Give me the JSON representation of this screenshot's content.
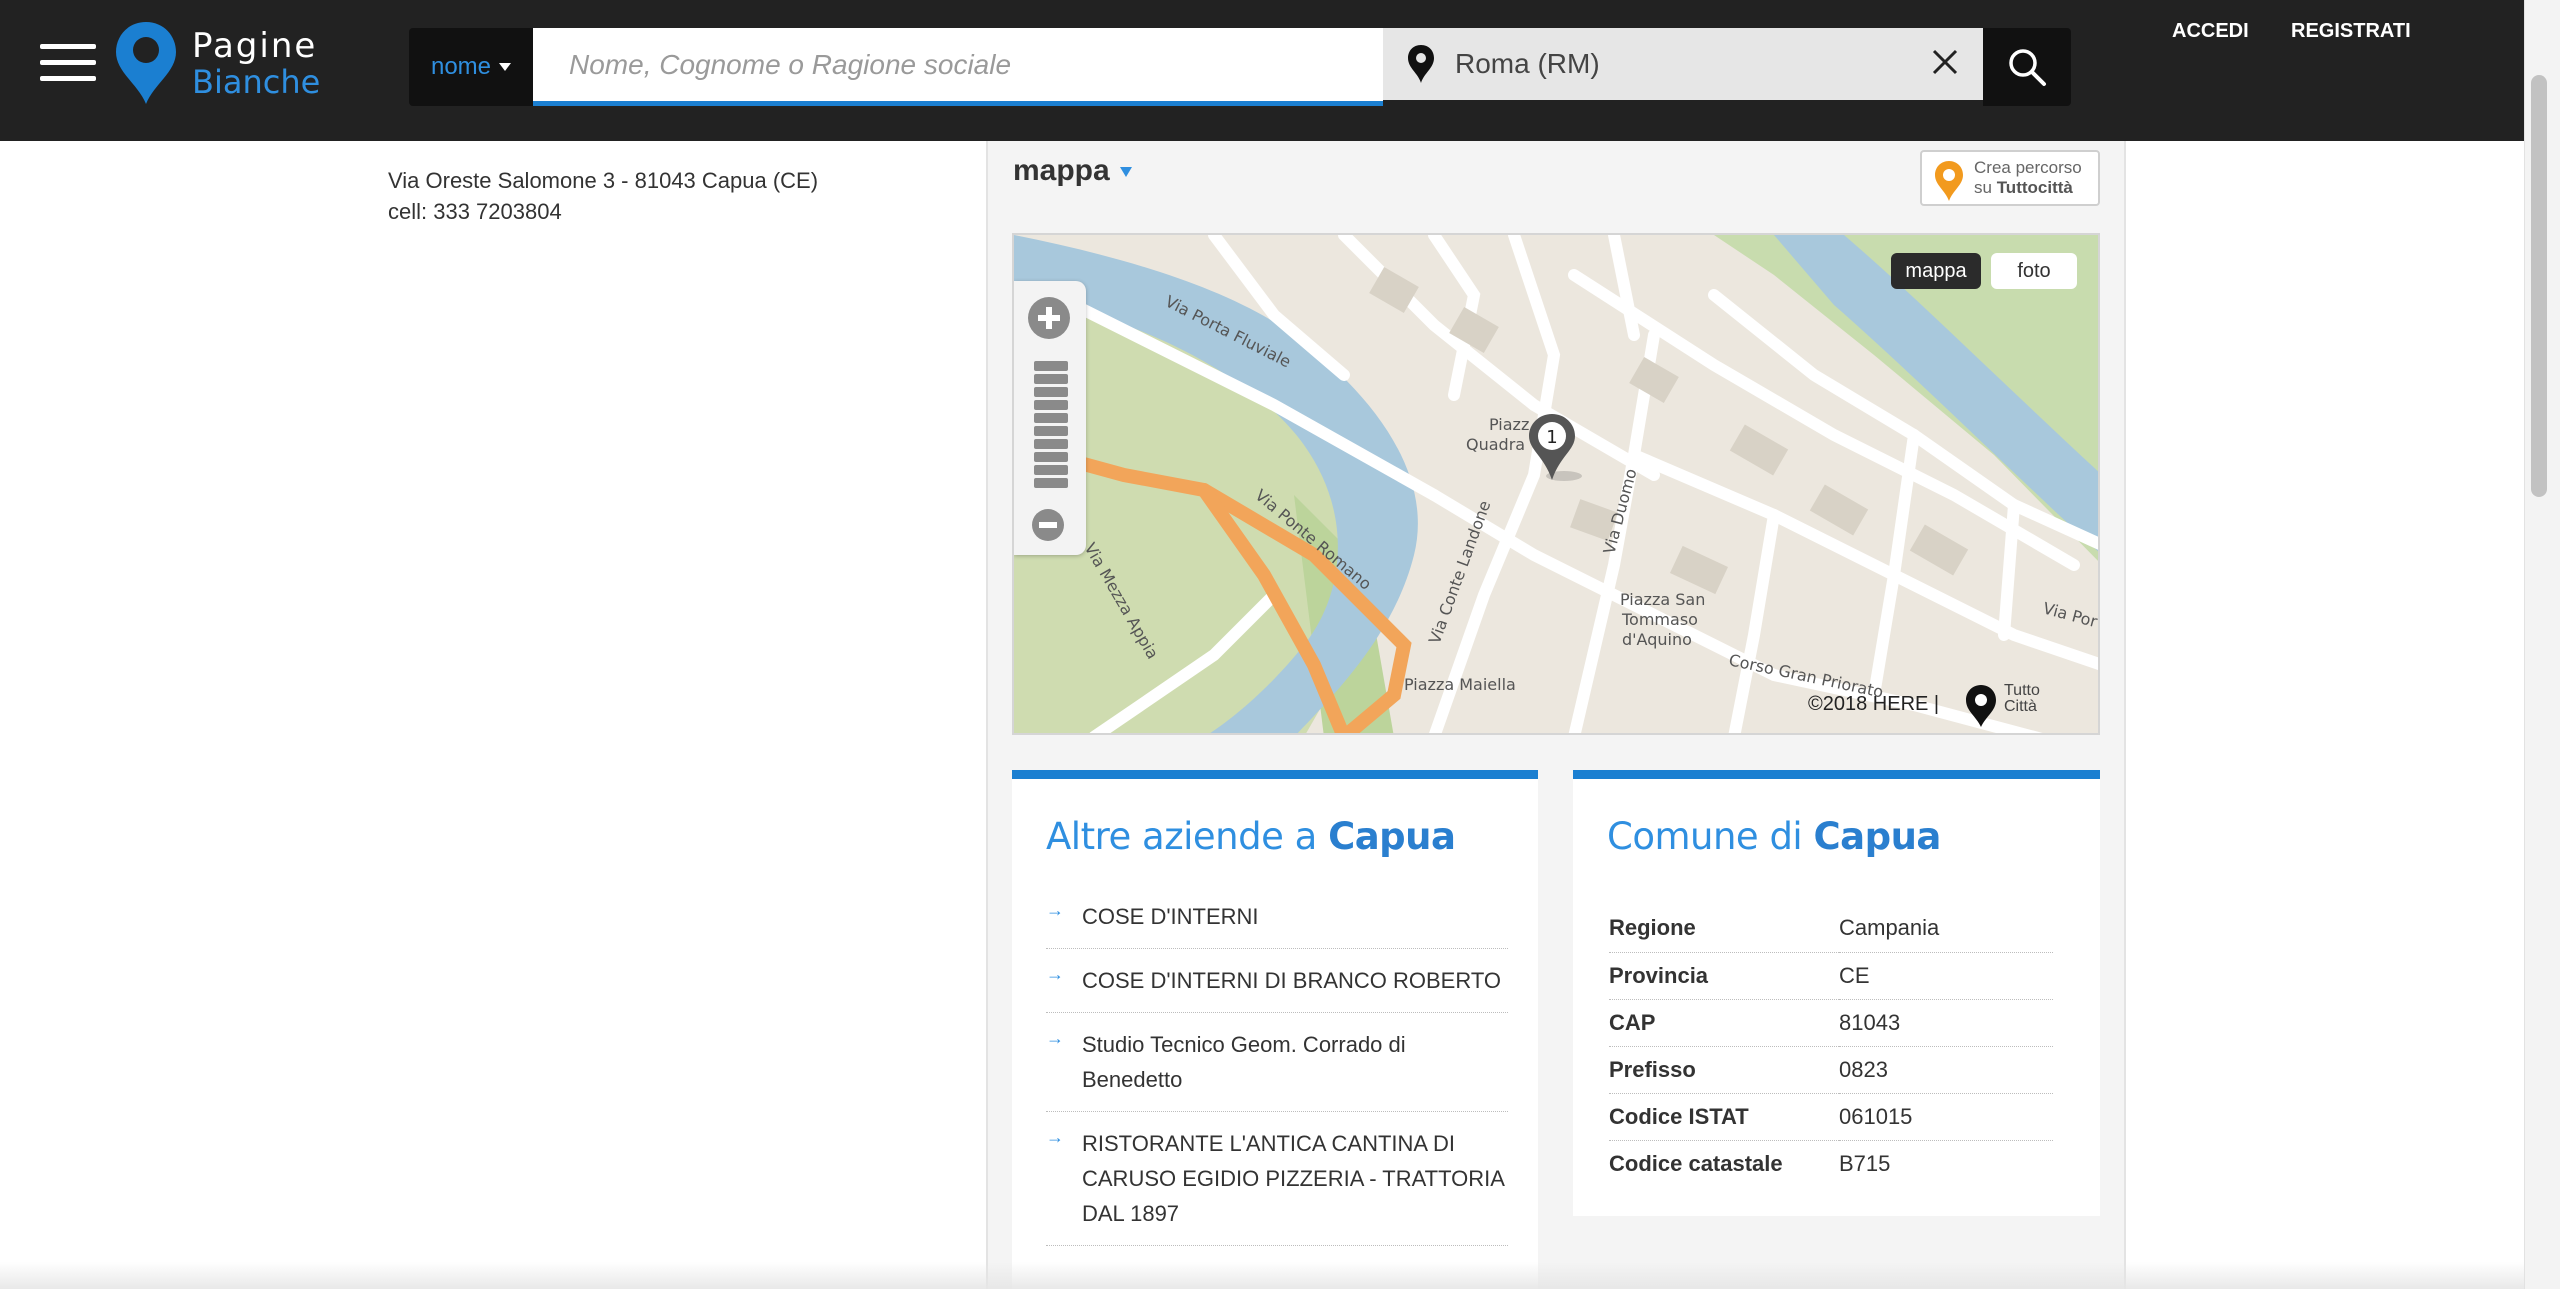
{
  "header": {
    "logo": {
      "line1": "Pagine",
      "line2": "Bianche"
    },
    "search": {
      "type_label": "nome",
      "name_placeholder": "Nome, Cognome o Ragione sociale",
      "location_value": "Roma (RM)"
    },
    "accedi": "ACCEDI",
    "registrati": "REGISTRATI"
  },
  "listing": {
    "address": "Via Oreste Salomone 3 - 81043 Capua (CE)",
    "cell": "cell: 333 7203804"
  },
  "map": {
    "title": "mappa",
    "crea": {
      "line1": "Crea percorso",
      "line2_prefix": "su ",
      "line2_brand": "Tuttocittà"
    },
    "toggle": {
      "map": "mappa",
      "photo": "foto"
    },
    "marker_number": "1",
    "copyright": "©2018 HERE |",
    "tutto_line1": "Tutto",
    "tutto_line2": "Città",
    "labels": {
      "porta_fluviale": "Via Porta Fluviale",
      "ponte_romano": "Via Ponte Romano",
      "mezza_appia": "Via Mezza Appia",
      "conte_landone": "Via Conte Landone",
      "duomo": "Via Duomo",
      "piazza_quadra_1": "Piazz",
      "piazza_quadra_2": "Quadra",
      "san_tommaso_1": "Piazza San",
      "san_tommaso_2": "Tommaso",
      "san_tommaso_3": "d'Aquino",
      "gran_priorato": "Corso Gran Priorato",
      "piazza_maiella": "Piazza Maiella",
      "via_por": "Via Por"
    }
  },
  "altre_aziende": {
    "title_prefix": "Altre aziende a ",
    "title_city": "Capua",
    "items": [
      "COSE D'INTERNI",
      "COSE D'INTERNI DI BRANCO ROBERTO",
      "Studio Tecnico Geom. Corrado di Benedetto",
      "RISTORANTE L'ANTICA CANTINA DI CARUSO EGIDIO PIZZERIA - TRATTORIA DAL 1897"
    ]
  },
  "comune": {
    "title_prefix": "Comune di ",
    "title_city": "Capua",
    "rows": [
      {
        "key": "Regione",
        "value": "Campania"
      },
      {
        "key": "Provincia",
        "value": "CE"
      },
      {
        "key": "CAP",
        "value": "81043"
      },
      {
        "key": "Prefisso",
        "value": "0823"
      },
      {
        "key": "Codice ISTAT",
        "value": "061015"
      },
      {
        "key": "Codice catastale",
        "value": "B715"
      }
    ]
  },
  "colors": {
    "header_bg": "#222222",
    "accent_blue": "#1b7fd1",
    "title_blue": "#2f8fe0",
    "route_orange": "#f2a55a"
  },
  "icons": [
    "menu-icon",
    "logo-pin-icon",
    "location-pin-icon",
    "close-icon",
    "search-icon",
    "route-pin-icon",
    "map-marker-icon",
    "tuttocitta-pin-icon"
  ]
}
